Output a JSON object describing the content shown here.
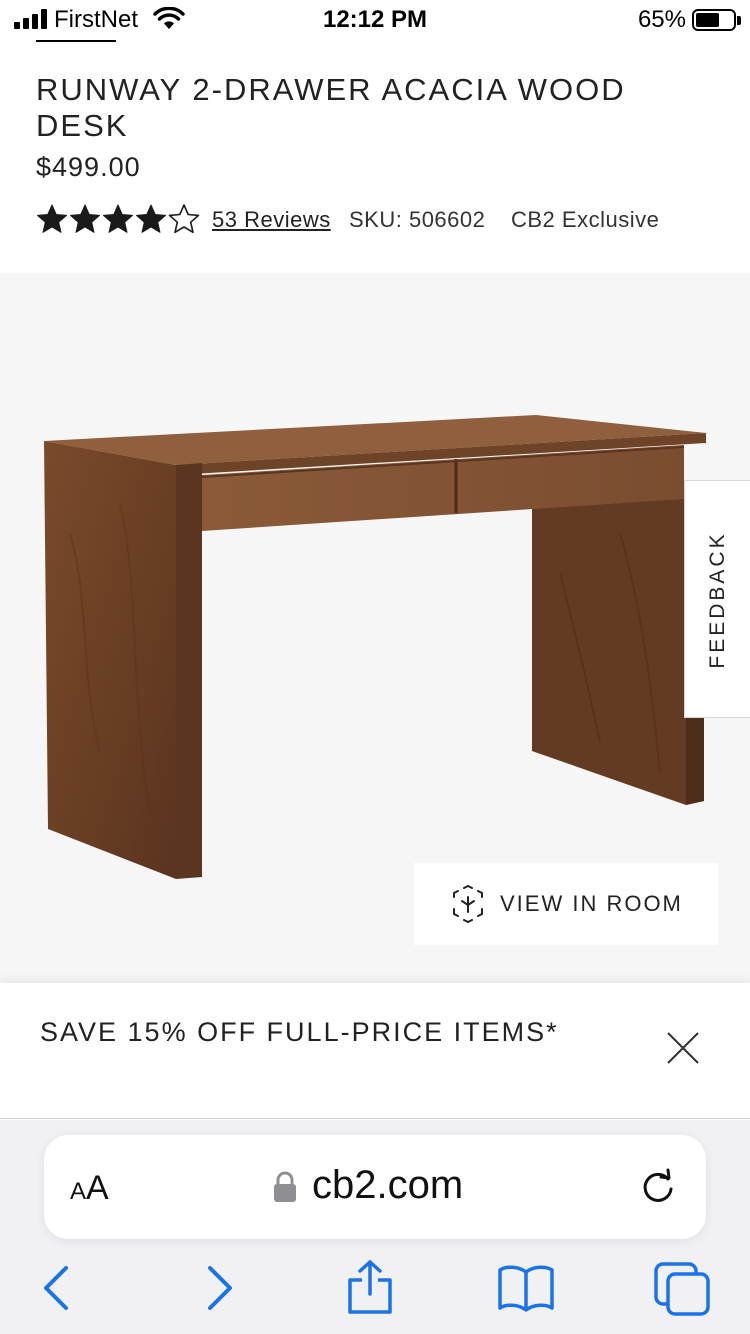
{
  "status_bar": {
    "carrier": "FirstNet",
    "time": "12:12 PM",
    "battery_percent": "65%",
    "battery_level": 0.65,
    "icons": [
      "signal-icon",
      "wifi-icon",
      "battery-icon"
    ]
  },
  "product": {
    "title": "RUNWAY 2-DRAWER ACACIA WOOD DESK",
    "price": "$499.00",
    "rating": 4,
    "rating_max": 5,
    "reviews_label": "53 Reviews",
    "sku_label": "SKU: 506602",
    "exclusive_label": "CB2 Exclusive"
  },
  "image": {
    "feedback_label": "FEEDBACK",
    "view_in_room_label": "VIEW IN ROOM",
    "background": "#f6f6f6"
  },
  "promo": {
    "text": "SAVE 15% OFF FULL-PRICE ITEMS*"
  },
  "browser": {
    "text_size_small": "A",
    "text_size_big": "A",
    "url": "cb2.com",
    "accent_color": "#1a73e8",
    "toolbar": [
      "back-icon",
      "forward-icon",
      "share-icon",
      "bookmarks-icon",
      "tabs-icon"
    ]
  }
}
